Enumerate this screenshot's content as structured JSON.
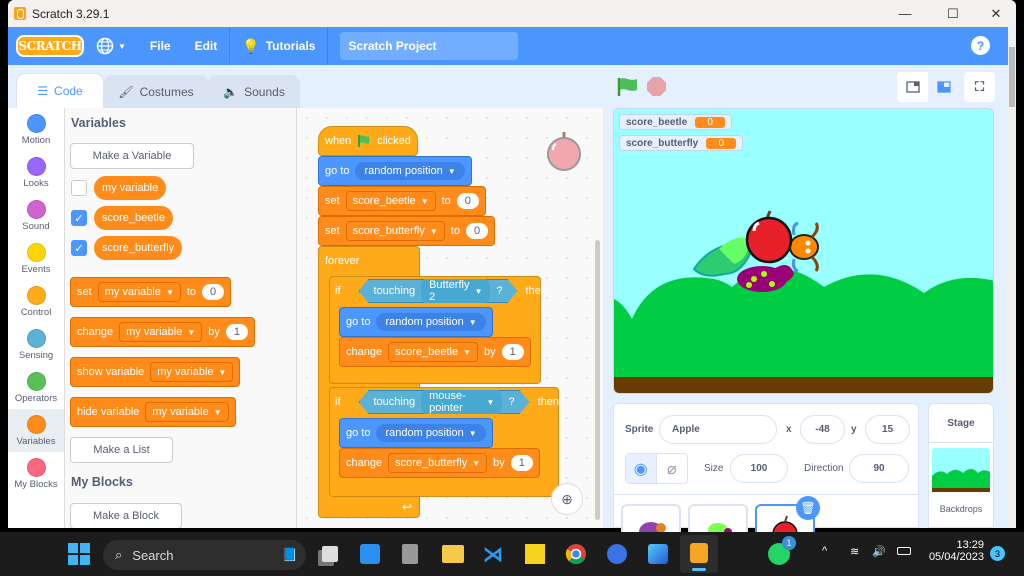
{
  "window": {
    "title": "Scratch 3.29.1",
    "controls": [
      "minimize",
      "maximize",
      "close"
    ]
  },
  "menubar": {
    "logo": "SCRATCH",
    "file": "File",
    "edit": "Edit",
    "tutorials": "Tutorials",
    "project_title": "Scratch Project",
    "help": "?"
  },
  "tabs": [
    {
      "label": "Code",
      "active": true
    },
    {
      "label": "Costumes"
    },
    {
      "label": "Sounds"
    }
  ],
  "categories": [
    {
      "label": "Motion",
      "color": "#4c97ff"
    },
    {
      "label": "Looks",
      "color": "#9966ff"
    },
    {
      "label": "Sound",
      "color": "#cf63cf"
    },
    {
      "label": "Events",
      "color": "#ffd500"
    },
    {
      "label": "Control",
      "color": "#ffab19"
    },
    {
      "label": "Sensing",
      "color": "#5cb1d6"
    },
    {
      "label": "Operators",
      "color": "#59c059"
    },
    {
      "label": "Variables",
      "color": "#ff8c1a",
      "selected": true
    },
    {
      "label": "My Blocks",
      "color": "#ff6680"
    }
  ],
  "palette": {
    "variables_heading": "Variables",
    "make_variable": "Make a Variable",
    "variables": [
      {
        "name": "my variable",
        "checked": false
      },
      {
        "name": "score_beetle",
        "checked": true
      },
      {
        "name": "score_butterfly",
        "checked": true
      }
    ],
    "set_block": {
      "verb": "set",
      "var": "my variable",
      "to": "to",
      "value": "0"
    },
    "change_block": {
      "verb": "change",
      "var": "my variable",
      "by": "by",
      "value": "1"
    },
    "show_block": {
      "verb": "show variable",
      "var": "my variable"
    },
    "hide_block": {
      "verb": "hide variable",
      "var": "my variable"
    },
    "make_list": "Make a List",
    "myblocks_heading": "My Blocks",
    "make_block": "Make a Block"
  },
  "script": {
    "hat": {
      "when": "when",
      "clicked": "clicked"
    },
    "goto1": {
      "verb": "go to",
      "target": "random position"
    },
    "set1": {
      "verb": "set",
      "var": "score_beetle",
      "to": "to",
      "value": "0"
    },
    "set2": {
      "verb": "set",
      "var": "score_butterfly",
      "to": "to",
      "value": "0"
    },
    "forever": "forever",
    "if1": {
      "if": "if",
      "touching": "touching",
      "target": "Butterfly 2",
      "q": "?",
      "then": "then"
    },
    "goto2": {
      "verb": "go to",
      "target": "random position"
    },
    "change1": {
      "verb": "change",
      "var": "score_beetle",
      "by": "by",
      "value": "1"
    },
    "if2": {
      "if": "if",
      "touching": "touching",
      "target": "mouse-pointer",
      "q": "?",
      "then": "then"
    },
    "goto3": {
      "verb": "go to",
      "target": "random position"
    },
    "change2": {
      "verb": "change",
      "var": "score_butterfly",
      "by": "by",
      "value": "1"
    }
  },
  "monitors": [
    {
      "label": "score_beetle",
      "value": "0"
    },
    {
      "label": "score_butterfly",
      "value": "0"
    }
  ],
  "sprite_info": {
    "sprite_label": "Sprite",
    "sprite_name": "Apple",
    "x_label": "x",
    "x": "-48",
    "y_label": "y",
    "y": "15",
    "size_label": "Size",
    "size": "100",
    "direction_label": "Direction",
    "direction": "90"
  },
  "stage_panel": {
    "title": "Stage",
    "backdrops_label": "Backdrops"
  },
  "taskbar": {
    "search_placeholder": "Search",
    "time": "13:29",
    "date": "05/04/2023",
    "whatsapp_badge": "1",
    "notification_count": "3"
  }
}
